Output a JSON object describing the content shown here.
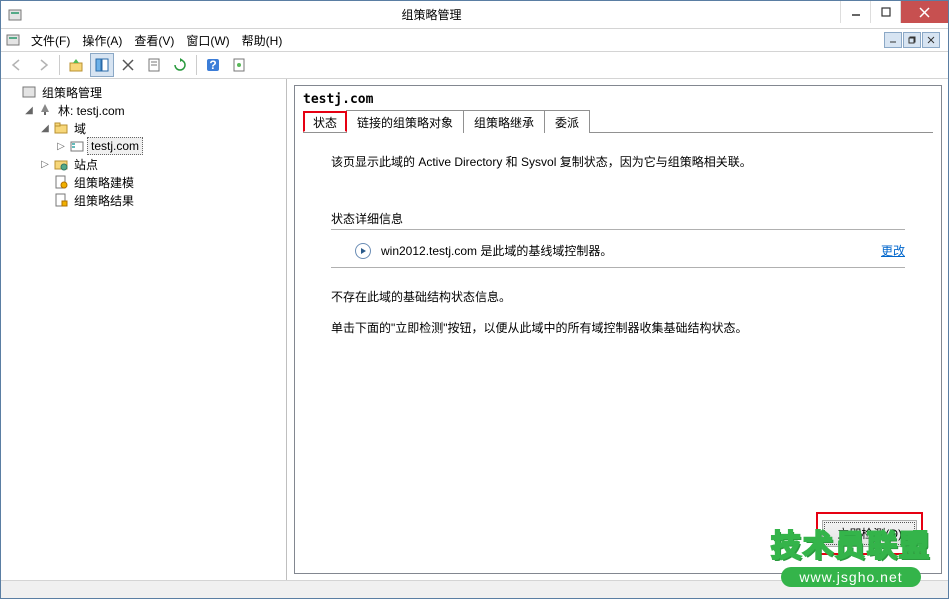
{
  "title": "组策略管理",
  "menu": {
    "file": "文件(F)",
    "action": "操作(A)",
    "view": "查看(V)",
    "window": "窗口(W)",
    "help": "帮助(H)"
  },
  "tree": {
    "root": "组策略管理",
    "forest": "林: testj.com",
    "domains": "域",
    "domain": "testj.com",
    "sites": "站点",
    "modeling": "组策略建模",
    "results": "组策略结果"
  },
  "detail": {
    "title": "testj.com",
    "tabs": {
      "status": "状态",
      "linked": "链接的组策略对象",
      "inherit": "组策略继承",
      "delegate": "委派"
    },
    "intro": "该页显示此域的 Active Directory 和 Sysvol 复制状态，因为它与组策略相关联。",
    "status_details_label": "状态详细信息",
    "baseline": "win2012.testj.com 是此域的基线域控制器。",
    "change": "更改",
    "noinfo": "不存在此域的基础结构状态信息。",
    "instruct": "单击下面的\"立即检测\"按钮，以便从此域中的所有域控制器收集基础结构状态。",
    "detect_btn": "立即检测(D)"
  },
  "watermark": {
    "line1": "技术员联盟",
    "line2": "www.jsgho.net"
  }
}
